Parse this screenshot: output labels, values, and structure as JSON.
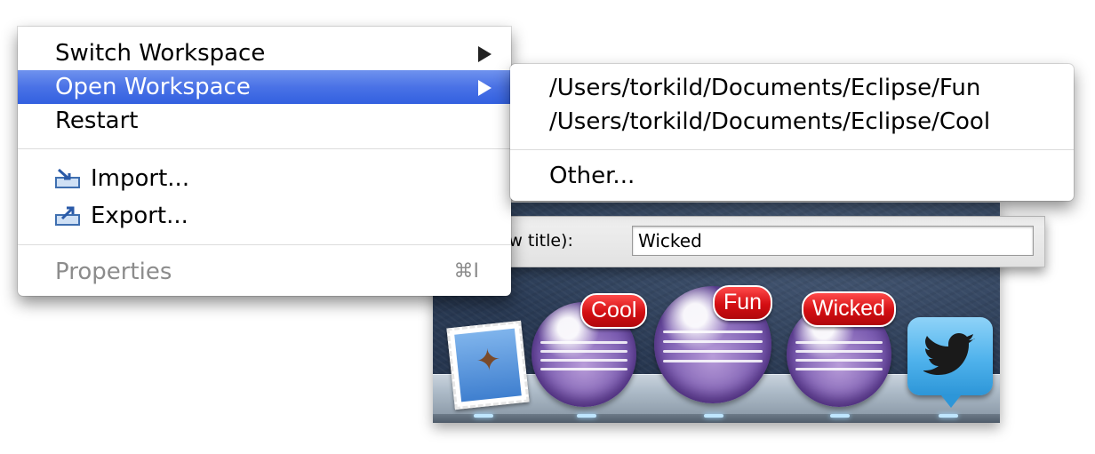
{
  "menu": {
    "items": [
      {
        "label": "Switch Workspace"
      },
      {
        "label": "Open Workspace"
      },
      {
        "label": "Restart"
      },
      {
        "label": "Import..."
      },
      {
        "label": "Export..."
      },
      {
        "label": "Properties",
        "shortcut": "⌘I"
      }
    ]
  },
  "submenu": {
    "items": [
      {
        "label": "/Users/torkild/Documents/Eclipse/Fun"
      },
      {
        "label": "/Users/torkild/Documents/Eclipse/Cool"
      },
      {
        "label": "Other..."
      }
    ]
  },
  "workspace_bar": {
    "label": "Workspace name (shown in window title):",
    "value": "Wicked"
  },
  "dock": {
    "badges": [
      "Cool",
      "Fun",
      "Wicked"
    ],
    "icons": [
      "mail-icon",
      "eclipse-icon",
      "eclipse-icon",
      "eclipse-icon",
      "twitter-icon"
    ]
  },
  "colors": {
    "selection": "#3f6ae2",
    "badge": "#d30e12",
    "twitter": "#4fb2ec",
    "eclipse": "#7a5bb0"
  }
}
